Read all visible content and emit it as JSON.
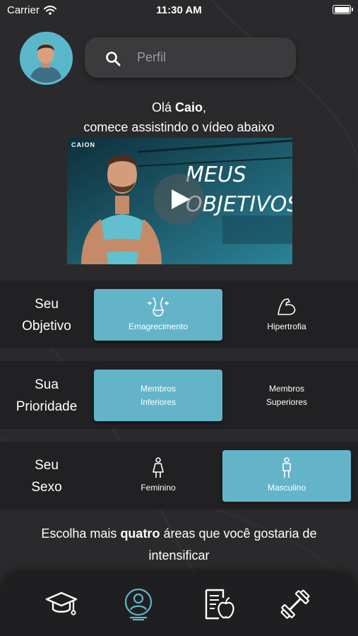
{
  "status_bar": {
    "carrier": "Carrier",
    "time": "11:30 AM"
  },
  "search": {
    "placeholder": "Perfil",
    "value": ""
  },
  "greeting": {
    "prefix": "Olá ",
    "name": "Caio",
    "suffix": ",",
    "line2": "comece assistindo o vídeo abaixo"
  },
  "video": {
    "brand": "CAION",
    "title_line1": "MEUS",
    "title_line2": "OBJETIVOS"
  },
  "sections": {
    "objetivo": {
      "label_line1": "Seu",
      "label_line2": "Objetivo",
      "options": [
        {
          "label": "Emagrecimento",
          "selected": true,
          "icon": "waist-icon"
        },
        {
          "label": "Hipertrofia",
          "selected": false,
          "icon": "bicep-icon"
        }
      ]
    },
    "prioridade": {
      "label_line1": "Sua",
      "label_line2": "Prioridade",
      "options": [
        {
          "label_line1": "Membros",
          "label_line2": "Inferiores",
          "selected": true
        },
        {
          "label_line1": "Membros",
          "label_line2": "Superiores",
          "selected": false
        }
      ]
    },
    "sexo": {
      "label_line1": "Seu",
      "label_line2": "Sexo",
      "options": [
        {
          "label": "Feminino",
          "selected": false,
          "icon": "female-icon"
        },
        {
          "label": "Masculino",
          "selected": true,
          "icon": "male-icon"
        }
      ]
    }
  },
  "instruction": {
    "prefix": "Escolha mais ",
    "emphasis": "quatro",
    "suffix": " áreas que você gostaria de intensificar"
  },
  "nav": [
    {
      "icon": "graduation-cap-icon",
      "active": false
    },
    {
      "icon": "profile-icon",
      "active": true
    },
    {
      "icon": "diet-document-icon",
      "active": false
    },
    {
      "icon": "dumbbell-icon",
      "active": false
    }
  ],
  "colors": {
    "accent": "#64b4c9",
    "background": "#2a2a2c",
    "section_bg": "#212123",
    "nav_bg": "#1f1f21"
  }
}
